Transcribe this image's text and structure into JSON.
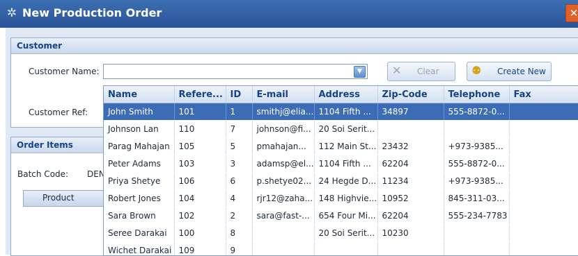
{
  "window": {
    "title": "New Production Order",
    "close_label": "✕"
  },
  "customer_group": {
    "title": "Customer",
    "name_label": "Customer Name:",
    "name_value": "",
    "ref_label": "Customer Ref:",
    "clear_label": "Clear",
    "create_new_label": "Create New"
  },
  "order_group": {
    "title": "Order Items",
    "batch_label": "Batch Code:",
    "batch_value": "DEN",
    "product_header": "Product"
  },
  "dropdown": {
    "columns": [
      "Name",
      "Refere...",
      "ID",
      "E-mail",
      "Address",
      "Zip-Code",
      "Telephone",
      "Fax"
    ],
    "rows": [
      [
        "John Smith",
        "101",
        "1",
        "smithj@elia...",
        "1104 Fifth ...",
        "34897",
        "555-8872-0...",
        ""
      ],
      [
        "Johnson Lan",
        "110",
        "7",
        "johnson@fi...",
        "20  Soi Serit...",
        "",
        "",
        ""
      ],
      [
        "Parag Mahajan",
        "105",
        "5",
        "pmahajan...",
        "112 Main St...",
        "23432",
        "+973-9385...",
        ""
      ],
      [
        "Peter Adams",
        "103",
        "3",
        "adamsp@el...",
        "1104 Fifth ...",
        "62204",
        "555-8872-0...",
        ""
      ],
      [
        "Priya Shetye",
        "106",
        "6",
        "p.shetye02...",
        "24 Hegde D...",
        "11234",
        "+973-9385...",
        ""
      ],
      [
        "Robert Jones",
        "104",
        "4",
        "rjr12@zaha...",
        "148 Highvie...",
        "10952",
        "845-311-03...",
        ""
      ],
      [
        "Sara Brown",
        "102",
        "2",
        "sara@fast-...",
        "654 Four Mi...",
        "62204",
        "555-234-7783",
        ""
      ],
      [
        "Seree Darakai",
        "100",
        "8",
        "",
        "20  Soi Serit...",
        "10230",
        "",
        ""
      ],
      [
        "Wichet Darakai",
        "109",
        "9",
        "",
        "",
        "",
        "",
        ""
      ]
    ],
    "selected_index": 0
  },
  "icons": {
    "window": "gear-icon",
    "combo": "chevron-down-icon",
    "clear": "close-icon",
    "create": "add-user-icon"
  },
  "colors": {
    "title_bar": "#2a5497",
    "selection": "#3d6cb6",
    "header_text": "#15428b"
  }
}
